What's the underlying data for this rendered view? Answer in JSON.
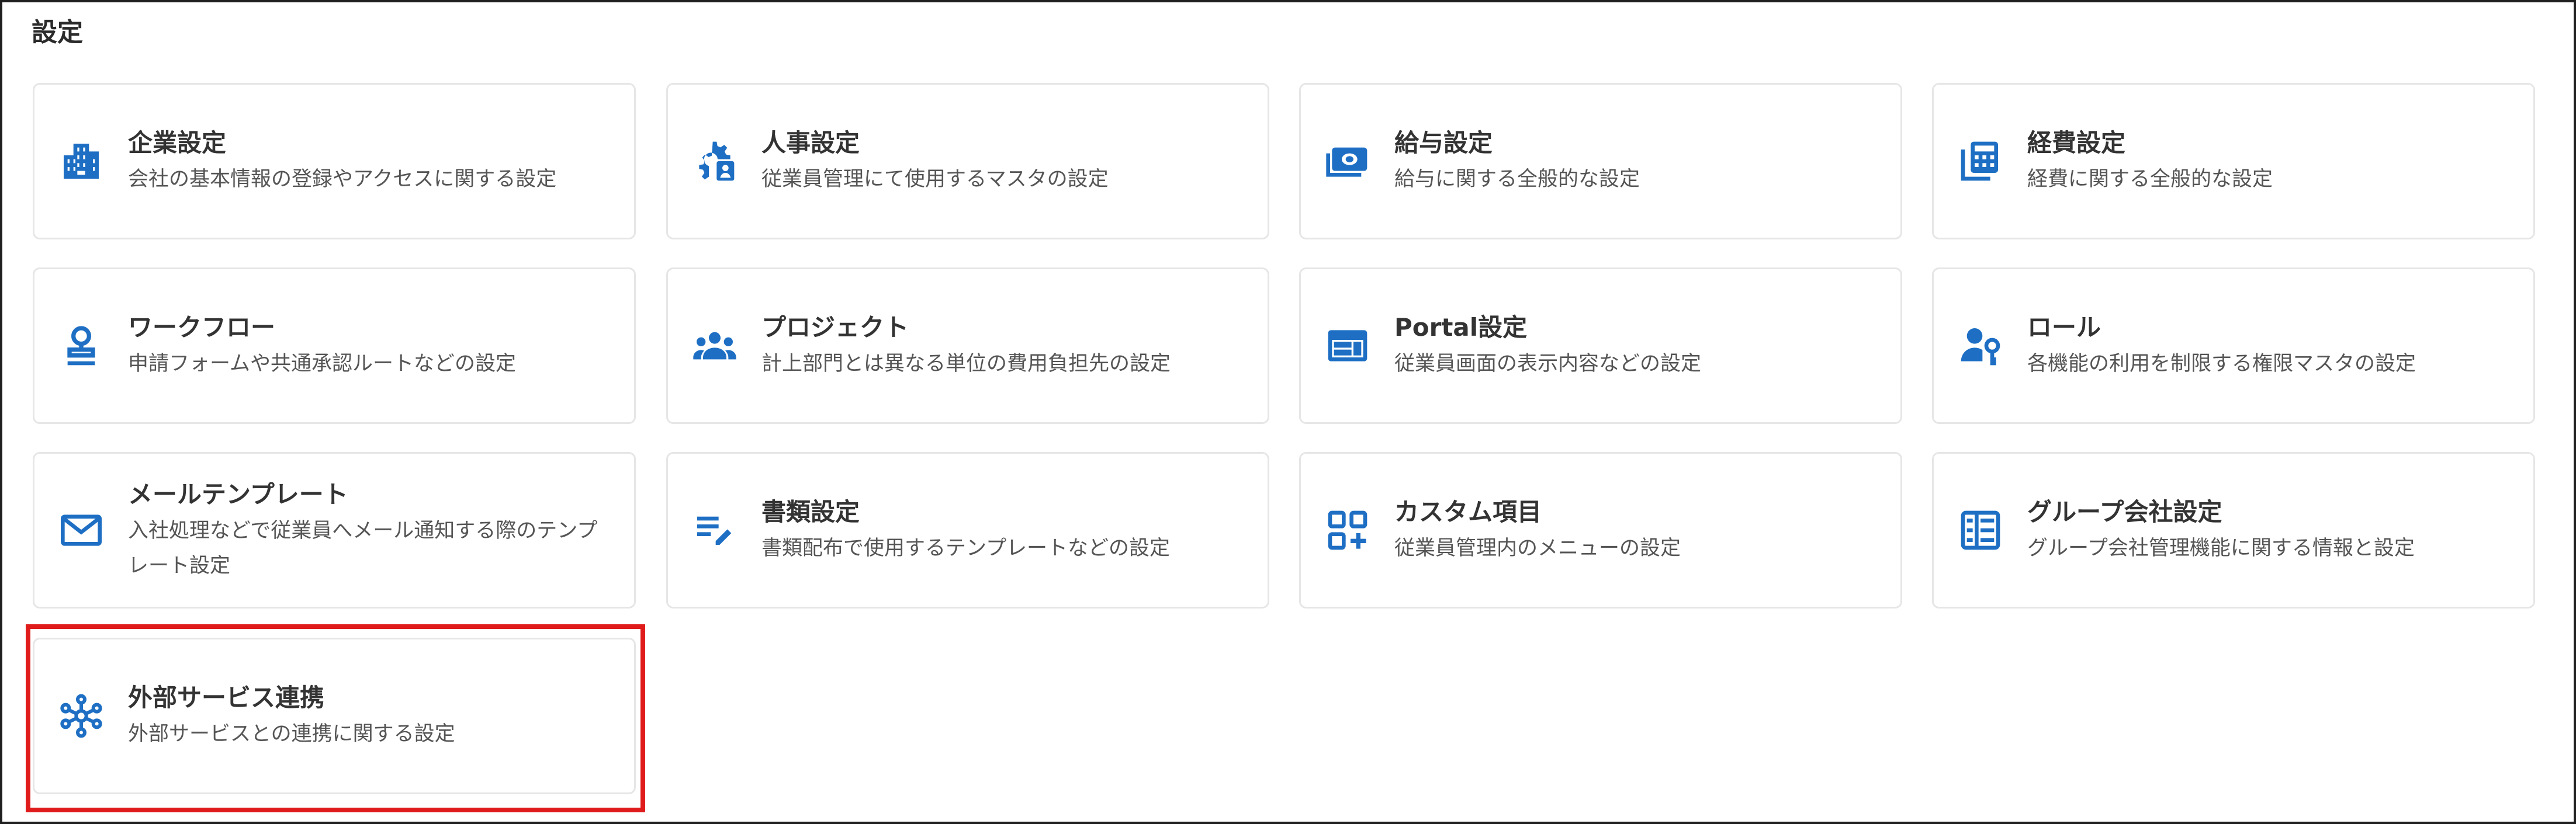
{
  "page": {
    "title": "設定"
  },
  "accent_color": "#1e6fc4",
  "highlight_color": "#e01b1b",
  "cards": [
    {
      "icon": "building-icon",
      "title": "企業設定",
      "desc": "会社の基本情報の登録やアクセスに関する設定"
    },
    {
      "icon": "gear-person-icon",
      "title": "人事設定",
      "desc": "従業員管理にて使用するマスタの設定"
    },
    {
      "icon": "money-icon",
      "title": "給与設定",
      "desc": "給与に関する全般的な設定"
    },
    {
      "icon": "calculator-icon",
      "title": "経費設定",
      "desc": "経費に関する全般的な設定"
    },
    {
      "icon": "stamp-icon",
      "title": "ワークフロー",
      "desc": "申請フォームや共通承認ルートなどの設定"
    },
    {
      "icon": "group-icon",
      "title": "プロジェクト",
      "desc": "計上部門とは異なる単位の費用負担先の設定"
    },
    {
      "icon": "portal-icon",
      "title": "Portal設定",
      "desc": "従業員画面の表示内容などの設定"
    },
    {
      "icon": "person-key-icon",
      "title": "ロール",
      "desc": "各機能の利用を制限する権限マスタの設定"
    },
    {
      "icon": "mail-icon",
      "title": "メールテンプレート",
      "desc": "入社処理などで従業員へメール通知する際のテンプレート設定"
    },
    {
      "icon": "document-edit-icon",
      "title": "書類設定",
      "desc": "書類配布で使用するテンプレートなどの設定"
    },
    {
      "icon": "grid-plus-icon",
      "title": "カスタム項目",
      "desc": "従業員管理内のメニューの設定"
    },
    {
      "icon": "org-list-icon",
      "title": "グループ会社設定",
      "desc": "グループ会社管理機能に関する情報と設定"
    },
    {
      "icon": "hub-icon",
      "title": "外部サービス連携",
      "desc": "外部サービスとの連携に関する設定"
    }
  ]
}
